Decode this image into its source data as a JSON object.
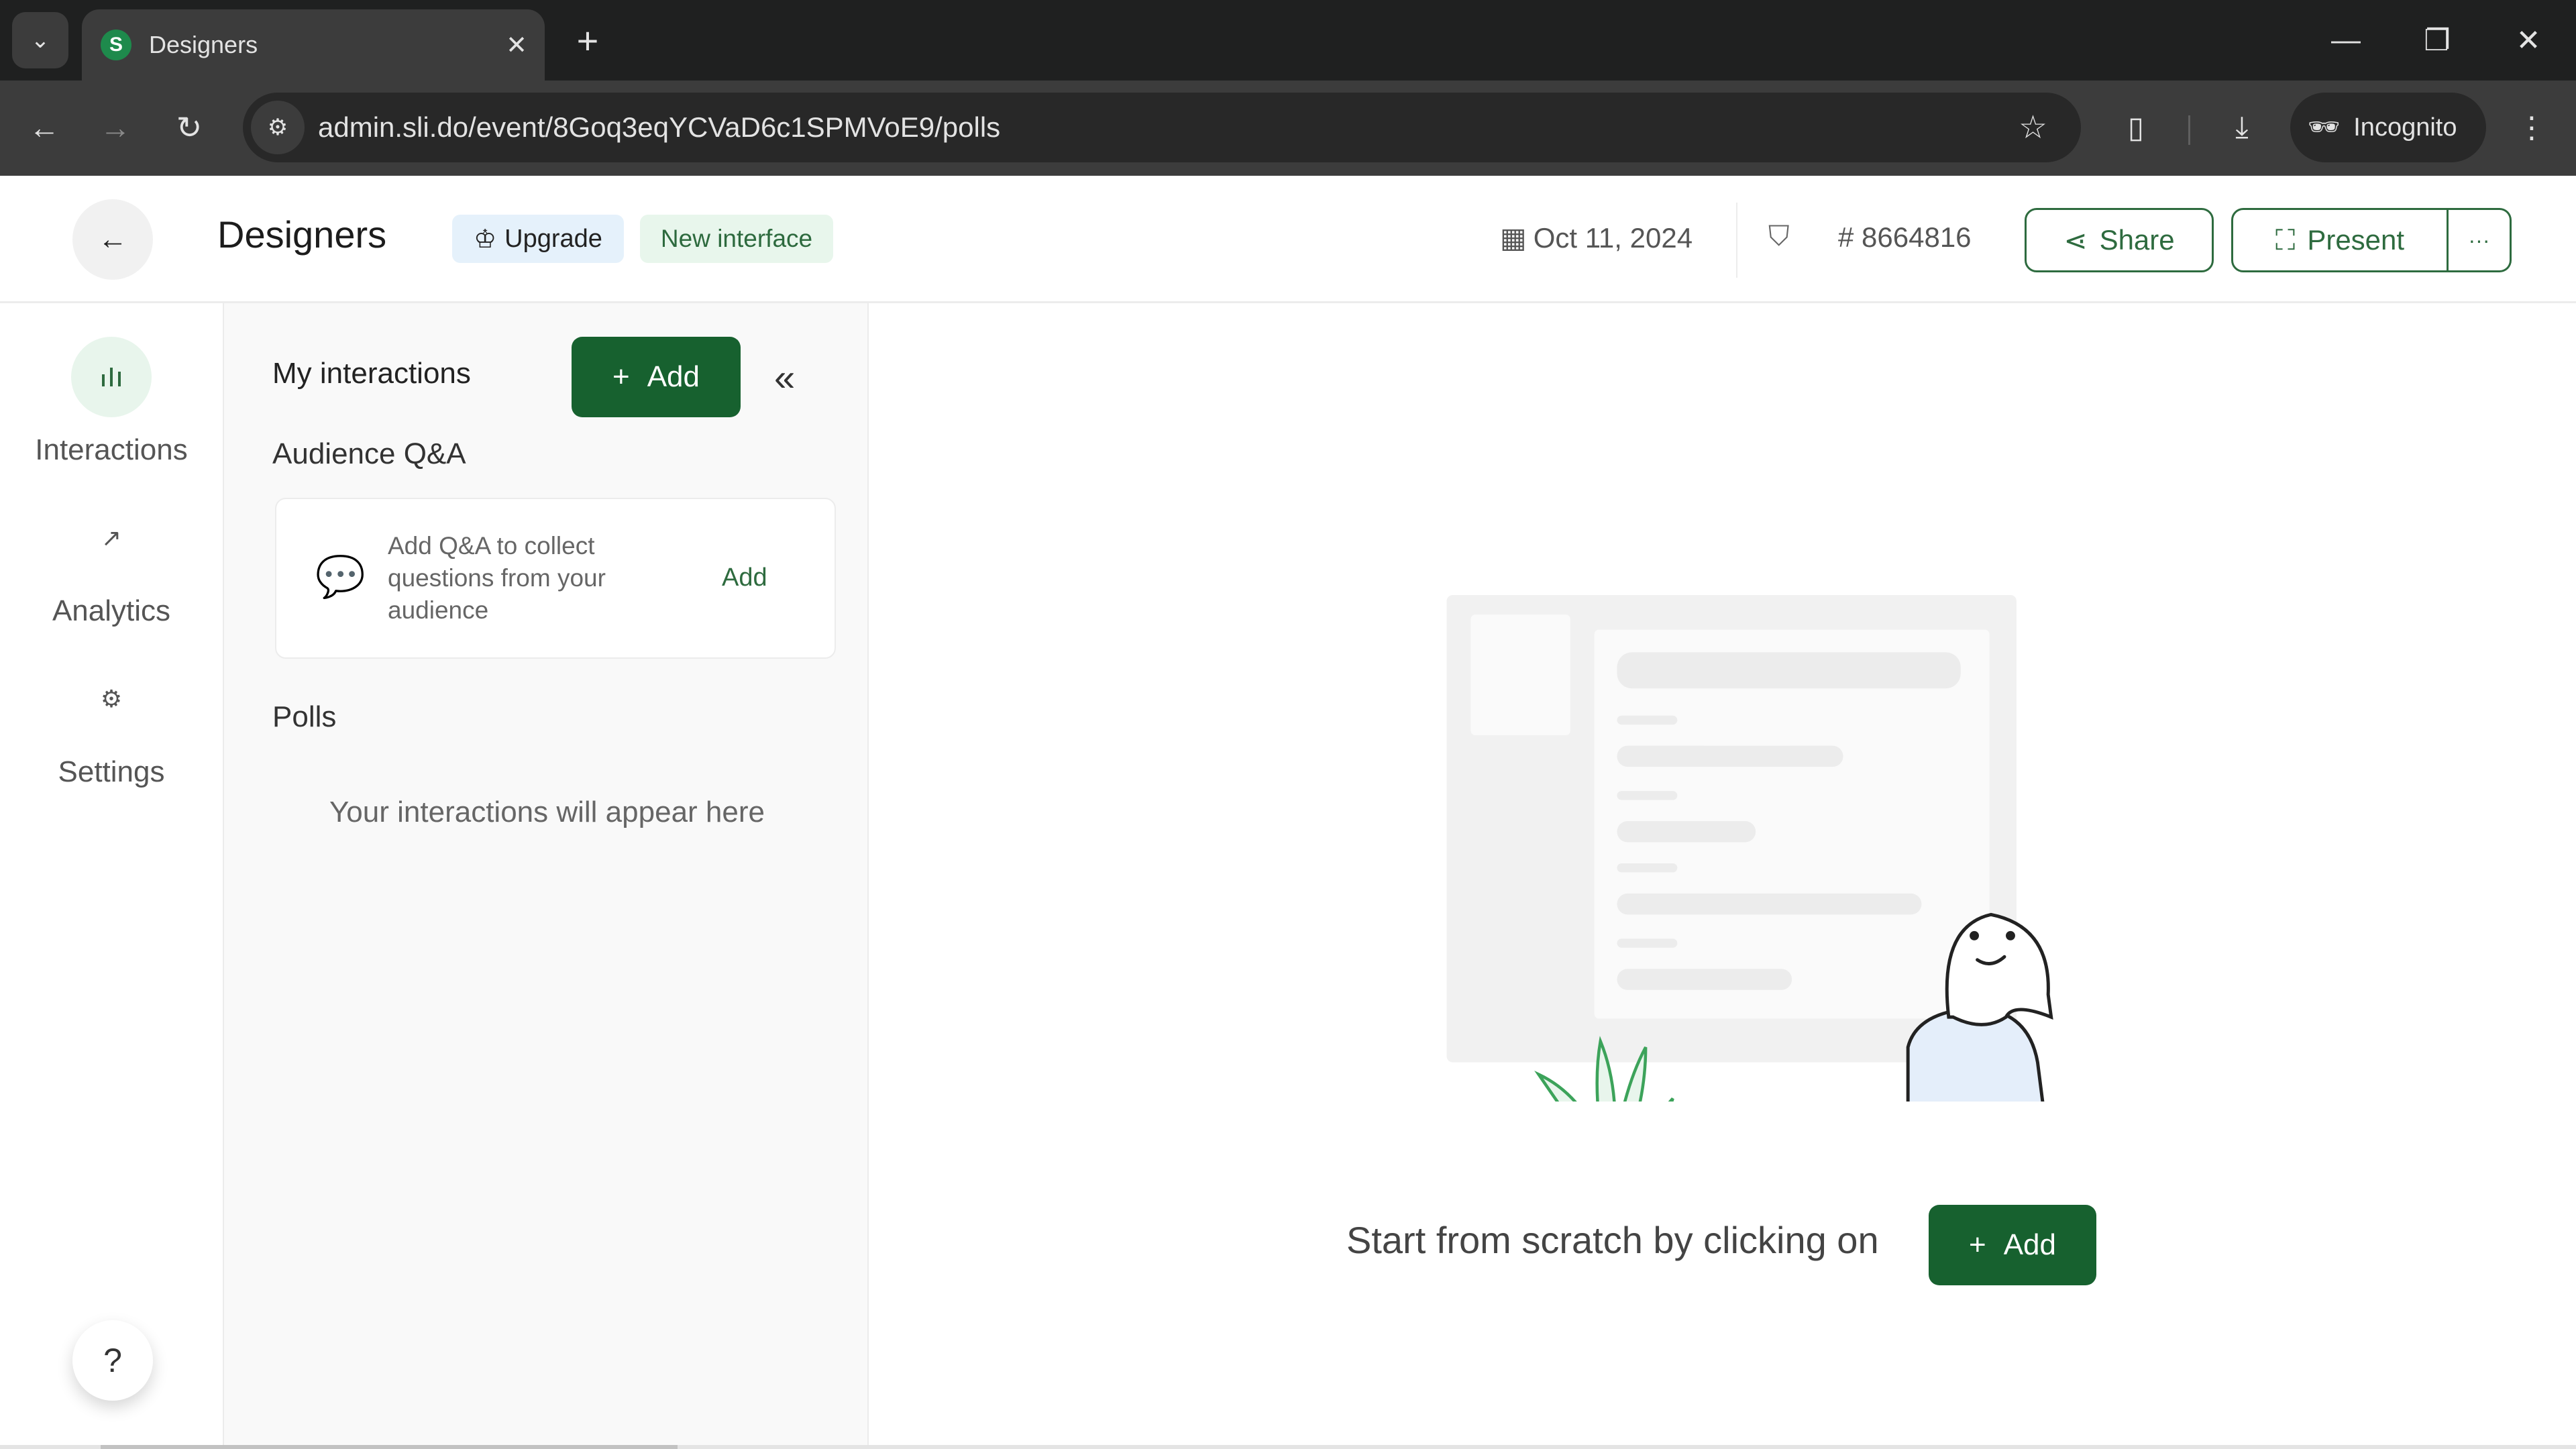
{
  "browser": {
    "tab_title": "Designers",
    "tab_favicon_letter": "S",
    "url": "admin.sli.do/event/8Goq3eqYCVaD6c1SPMVoE9/polls",
    "profile_label": "Incognito",
    "icons": {
      "tab_search": "chevron-down-icon",
      "tab_close": "close-icon",
      "new_tab": "plus-icon",
      "back": "arrow-left-icon",
      "forward": "arrow-right-icon",
      "reload": "reload-icon",
      "site_info": "tune-icon",
      "bookmark": "star-icon",
      "extensions": "puzzle-icon",
      "downloads": "download-icon",
      "menu": "kebab-icon"
    }
  },
  "header": {
    "event_title": "Designers",
    "upgrade_label": "Upgrade",
    "new_interface_label": "New interface",
    "date": "Oct 11, 2024",
    "event_code": "# 8664816",
    "share_label": "Share",
    "present_label": "Present",
    "more_label": "···"
  },
  "nav": {
    "items": [
      {
        "label": "Interactions",
        "icon": "bar-chart-icon",
        "active": true
      },
      {
        "label": "Analytics",
        "icon": "trend-up-icon",
        "active": false
      },
      {
        "label": "Settings",
        "icon": "gear-icon",
        "active": false
      }
    ],
    "help_label": "?"
  },
  "panel": {
    "title": "My interactions",
    "add_label": "Add",
    "audience_qa_title": "Audience Q&A",
    "qa_card_text": "Add Q&A to collect questions from your audience",
    "qa_card_add": "Add",
    "polls_title": "Polls",
    "empty_message": "Your interactions will appear here"
  },
  "main": {
    "cta_text": "Start from scratch by clicking on",
    "add_label": "Add"
  },
  "colors": {
    "brand_green": "#17612f",
    "accent_outline": "#2e6b3f",
    "upgrade_bg": "#e5f1fb",
    "new_interface_bg": "#e8f6ec"
  }
}
